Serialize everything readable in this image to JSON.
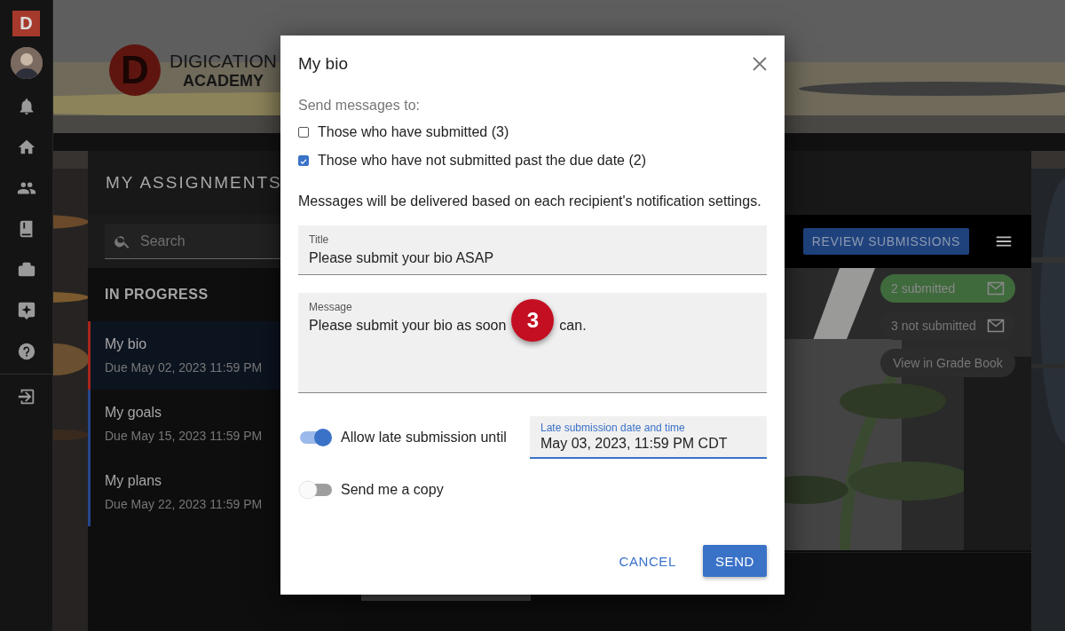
{
  "app_badge": "D",
  "logo": {
    "mark": "D",
    "name": "DIGICATION",
    "subtitle": "ACADEMY"
  },
  "panel": {
    "title": "MY ASSIGNMENTS",
    "search": {
      "placeholder": "Search"
    },
    "section": "IN PROGRESS",
    "assignments": [
      {
        "name": "My bio",
        "due": "Due May 02, 2023 11:59 PM",
        "selected": true,
        "color": "#a8261c"
      },
      {
        "name": "My goals",
        "due": "Due May 15, 2023 11:59 PM",
        "selected": false,
        "color": "#24478a"
      },
      {
        "name": "My plans",
        "due": "Due May 22, 2023 11:59 PM",
        "selected": false,
        "color": "#24478a"
      }
    ],
    "review_button": "REVIEW SUBMISSIONS",
    "status_pills": [
      {
        "label": "2 submitted",
        "kind": "submitted"
      },
      {
        "label": "3 not submitted",
        "kind": "pending"
      },
      {
        "label": "View in Grade Book",
        "kind": "link"
      }
    ]
  },
  "dialog": {
    "title": "My bio",
    "recipients_label": "Send messages to:",
    "recipients": [
      {
        "label": "Those who have submitted (3)",
        "checked": false
      },
      {
        "label": "Those who have not submitted past the due date (2)",
        "checked": true
      }
    ],
    "note": "Messages will be delivered based on each recipient's notification settings.",
    "title_field": {
      "label": "Title",
      "value": "Please submit your bio ASAP"
    },
    "message_field": {
      "label": "Message",
      "value_before": "Please submit your bio as soon",
      "value_after": "can."
    },
    "late_submission": {
      "label": "Allow late submission until",
      "on": true,
      "date_field": {
        "label": "Late submission date and time",
        "value": "May 03, 2023, 11:59 PM CDT"
      }
    },
    "send_copy": {
      "label": "Send me a copy",
      "on": false
    },
    "buttons": [
      {
        "label": "CANCEL",
        "kind": "text"
      },
      {
        "label": "SEND",
        "kind": "primary"
      }
    ]
  },
  "step_marker": "3"
}
